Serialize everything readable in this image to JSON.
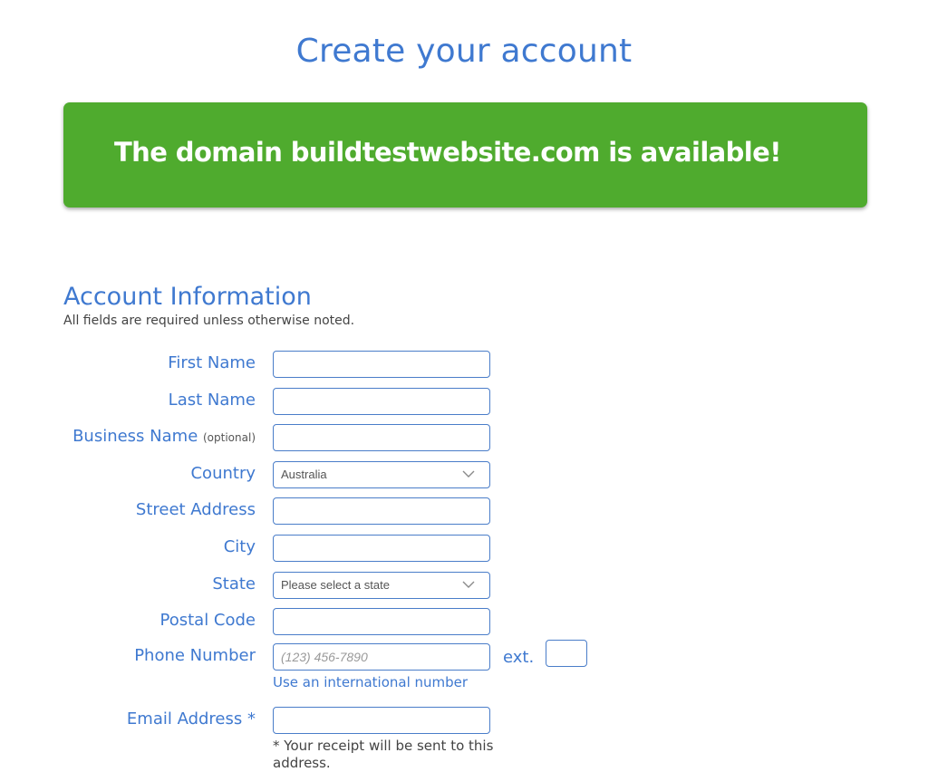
{
  "page": {
    "title": "Create your account"
  },
  "banner": {
    "message": "The domain buildtestwebsite.com is available!",
    "color": "#4fab2e"
  },
  "section": {
    "title": "Account Information",
    "note": "All fields are required unless otherwise noted."
  },
  "form": {
    "first_name": {
      "label": "First Name",
      "value": ""
    },
    "last_name": {
      "label": "Last Name",
      "value": ""
    },
    "business_name": {
      "label": "Business Name",
      "optional_tag": "(optional)",
      "value": ""
    },
    "country": {
      "label": "Country",
      "selected": "Australia"
    },
    "street_address": {
      "label": "Street Address",
      "value": ""
    },
    "city": {
      "label": "City",
      "value": ""
    },
    "state": {
      "label": "State",
      "selected": "Please select a state"
    },
    "postal_code": {
      "label": "Postal Code",
      "value": ""
    },
    "phone": {
      "label": "Phone Number",
      "placeholder": "(123) 456-7890",
      "value": "",
      "ext_label": "ext.",
      "ext_value": "",
      "intl_link": "Use an international number"
    },
    "email": {
      "label": "Email Address *",
      "value": "",
      "note": "* Your receipt will be sent to this address."
    }
  },
  "colors": {
    "accent": "#3f79d0",
    "input_border": "#4a7dc9",
    "success": "#4fab2e"
  }
}
